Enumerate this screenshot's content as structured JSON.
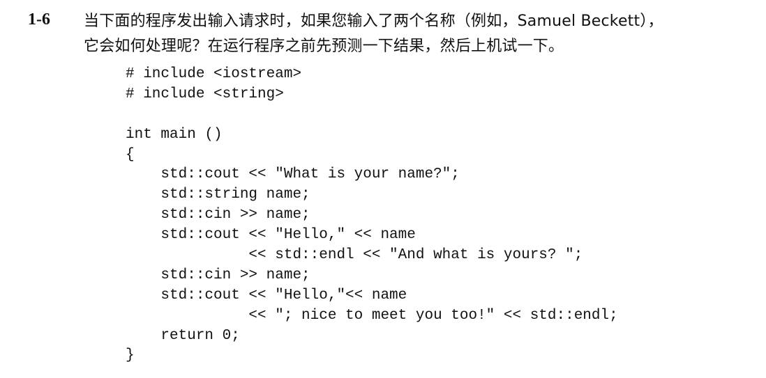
{
  "exercise": {
    "number": "1-6",
    "question_lines": [
      "当下面的程序发出输入请求时，如果您输入了两个名称（例如，Samuel Beckett），",
      "它会如何处理呢？在运行程序之前先预测一下结果，然后上机试一下。"
    ]
  },
  "code_lines": [
    "# include <iostream>",
    "# include <string>",
    "",
    "int main ()",
    "{",
    "    std::cout << \"What is your name?\";",
    "    std::string name;",
    "    std::cin >> name;",
    "    std::cout << \"Hello,\" << name",
    "              << std::endl << \"And what is yours? \";",
    "    std::cin >> name;",
    "    std::cout << \"Hello,\"<< name",
    "              << \"; nice to meet you too!\" << std::endl;",
    "    return 0;",
    "}"
  ]
}
